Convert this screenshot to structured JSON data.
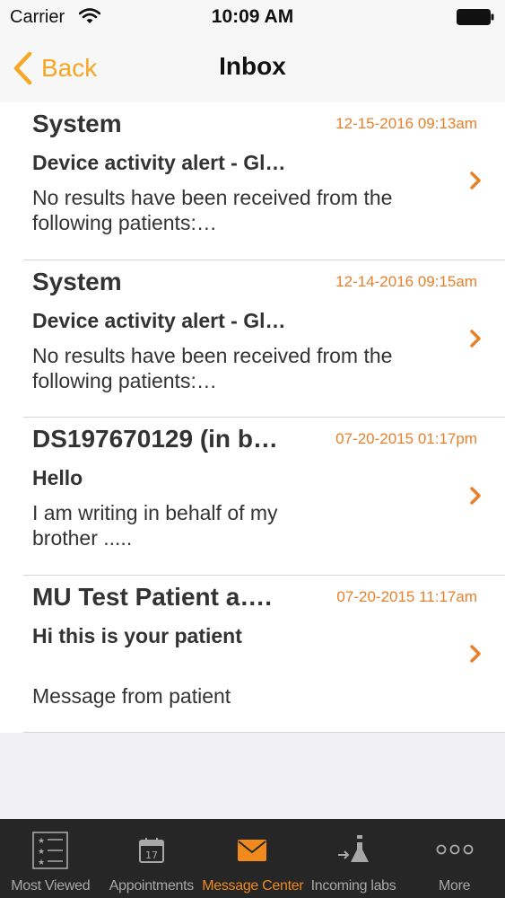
{
  "status_bar": {
    "carrier": "Carrier",
    "time": "10:09 AM"
  },
  "nav": {
    "back_label": "Back",
    "title": "Inbox"
  },
  "colors": {
    "accent": "#f5a623",
    "date": "#e8802a",
    "tab_active": "#f08a1c",
    "tab_bar": "#262626"
  },
  "messages": [
    {
      "sender": "System",
      "date": "12-15-2016 09:13am",
      "subject": "Device activity alert - Gl…",
      "preview": "No results have been received from the following patients:…"
    },
    {
      "sender": "System",
      "date": "12-14-2016 09:15am",
      "subject": "Device activity alert - Gl…",
      "preview": "No results have been received from the following patients:…"
    },
    {
      "sender": "DS197670129 (in b…",
      "date": "07-20-2015 01:17pm",
      "subject": "Hello",
      "preview": "I am writing in behalf of my brother ....."
    },
    {
      "sender": "MU Test Patient a….",
      "date": "07-20-2015 11:17am",
      "subject": "Hi this is your patient",
      "preview": "Message from patient"
    }
  ],
  "tabs": [
    {
      "label": "Most Viewed",
      "icon": "list-icon",
      "active": false
    },
    {
      "label": "Appointments",
      "icon": "calendar-icon",
      "active": false
    },
    {
      "label": "Message Center",
      "icon": "envelope-icon",
      "active": true
    },
    {
      "label": "Incoming labs",
      "icon": "flask-icon",
      "active": false
    },
    {
      "label": "More",
      "icon": "more-icon",
      "active": false
    }
  ],
  "calendar_day": "17"
}
